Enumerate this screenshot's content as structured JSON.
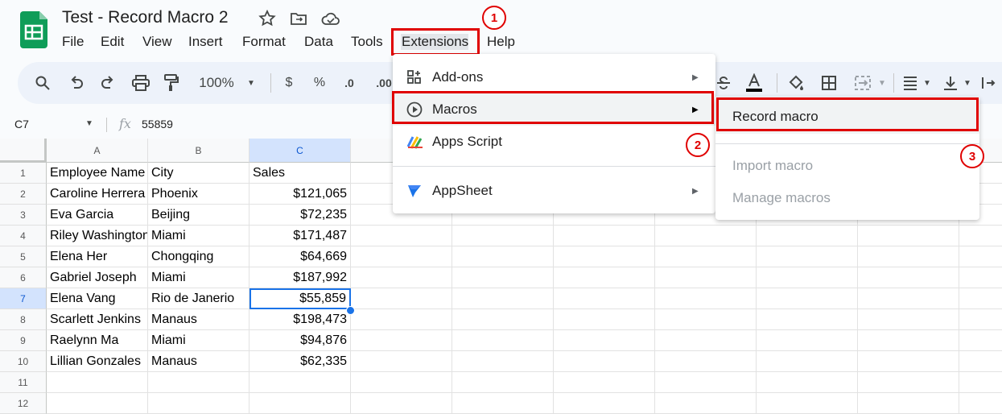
{
  "doc": {
    "title": "Test - Record Macro 2"
  },
  "menubar": [
    "File",
    "Edit",
    "View",
    "Insert",
    "Format",
    "Data",
    "Tools",
    "Extensions",
    "Help"
  ],
  "toolbar": {
    "zoom": "100%",
    "currency": "$",
    "percent": "%",
    "dec_decrease": ".0",
    "dec_increase": ".00"
  },
  "formula_bar": {
    "cell_ref": "C7",
    "fx": "fx",
    "value": "55859"
  },
  "columns": [
    "A",
    "B",
    "C"
  ],
  "rows": [
    "1",
    "2",
    "3",
    "4",
    "5",
    "6",
    "7",
    "8",
    "9",
    "10",
    "11",
    "12"
  ],
  "table": [
    [
      "Employee Name",
      "City",
      "Sales"
    ],
    [
      "Caroline Herrera",
      "Phoenix",
      "$121,065"
    ],
    [
      "Eva Garcia",
      "Beijing",
      "$72,235"
    ],
    [
      "Riley Washington",
      "Miami",
      "$171,487"
    ],
    [
      "Elena Her",
      "Chongqing",
      "$64,669"
    ],
    [
      "Gabriel Joseph",
      "Miami",
      "$187,992"
    ],
    [
      "Elena Vang",
      "Rio de Janerio",
      "$55,859"
    ],
    [
      "Scarlett Jenkins",
      "Manaus",
      "$198,473"
    ],
    [
      "Raelynn Ma",
      "Miami",
      "$94,876"
    ],
    [
      "Lillian Gonzales",
      "Manaus",
      "$62,335"
    ]
  ],
  "extensions_menu": {
    "items": [
      {
        "label": "Add-ons",
        "icon": "addons-icon"
      },
      {
        "label": "Macros",
        "icon": "play-circle-icon"
      },
      {
        "label": "Apps Script",
        "icon": "apps-script-icon"
      },
      {
        "label": "AppSheet",
        "icon": "appsheet-icon"
      }
    ]
  },
  "macros_submenu": {
    "items": [
      {
        "label": "Record macro",
        "enabled": true
      },
      {
        "label": "Import macro",
        "enabled": false
      },
      {
        "label": "Manage macros",
        "enabled": false
      }
    ]
  },
  "annotations": [
    "1",
    "2",
    "3"
  ],
  "colors": {
    "annotation_red": "#e00000",
    "selection_blue": "#1a73e8",
    "sheets_green": "#0f9d58"
  }
}
